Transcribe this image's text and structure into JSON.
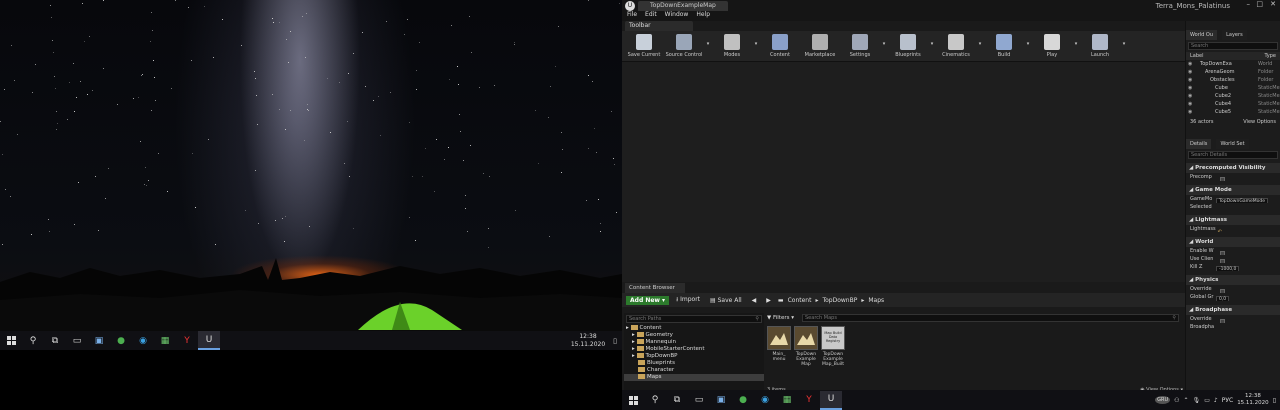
{
  "left_desktop": {
    "wallpaper": "milky-way-night-sky-with-tent",
    "taskbar": {
      "icons": [
        "windows-icon",
        "search-icon",
        "task-view-icon",
        "terminal-icon",
        "explorer-icon",
        "globe-icon",
        "edge-icon",
        "photos-icon",
        "yandex-icon",
        "unreal-icon"
      ],
      "time": "12:38",
      "date": "15.11.2020"
    }
  },
  "ue": {
    "logo": "U",
    "tab_title": "TopDownExampleMap",
    "project_name": "Terra_Mons_Palatinus",
    "menu": [
      "File",
      "Edit",
      "Window",
      "Help"
    ],
    "toolbar_tab": "Toolbar",
    "tools": [
      {
        "label": "Save Current",
        "icon": "save-icon",
        "color": "#c8d0da"
      },
      {
        "label": "Source Control",
        "icon": "source-control-icon",
        "color": "#9aa6b8"
      },
      {
        "label": "Modes",
        "icon": "modes-icon",
        "color": "#c0c0c0"
      },
      {
        "label": "Content",
        "icon": "content-icon",
        "color": "#8aa0c8"
      },
      {
        "label": "Marketplace",
        "icon": "marketplace-icon",
        "color": "#b0b0b0"
      },
      {
        "label": "Settings",
        "icon": "settings-icon",
        "color": "#a0a8b8"
      },
      {
        "label": "Blueprints",
        "icon": "blueprints-icon",
        "color": "#b8c0cc"
      },
      {
        "label": "Cinematics",
        "icon": "cinematics-icon",
        "color": "#c8c8c8"
      },
      {
        "label": "Build",
        "icon": "build-icon",
        "color": "#90a8d0"
      },
      {
        "label": "Play",
        "icon": "play-icon",
        "color": "#d8d8d8"
      },
      {
        "label": "Launch",
        "icon": "launch-icon",
        "color": "#b0b8c8"
      }
    ],
    "content_browser": {
      "tab": "Content Browser",
      "add_new": "Add New",
      "import": "Import",
      "save_all": "Save All",
      "breadcrumb": [
        "Content",
        "TopDownBP",
        "Maps"
      ],
      "search_paths_placeholder": "Search Paths",
      "filters": "Filters",
      "search_maps_placeholder": "Search Maps",
      "tree": [
        {
          "label": "Content",
          "level": 0
        },
        {
          "label": "Geometry",
          "level": 1
        },
        {
          "label": "Mannequin",
          "level": 1
        },
        {
          "label": "MobileStarterContent",
          "level": 1
        },
        {
          "label": "TopDownBP",
          "level": 1
        },
        {
          "label": "Blueprints",
          "level": 2
        },
        {
          "label": "Character",
          "level": 2
        },
        {
          "label": "Maps",
          "level": 2,
          "selected": true
        }
      ],
      "assets": [
        {
          "line1": "Main_",
          "line2": "menu",
          "line3": "",
          "type": "map"
        },
        {
          "line1": "TopDown",
          "line2": "Example",
          "line3": "Map",
          "type": "map"
        },
        {
          "line1": "TopDown",
          "line2": "Example",
          "line3": "Map_Built",
          "type": "build-data",
          "thumb_text": "Map Build Data Registry"
        }
      ],
      "item_count": "3 items",
      "view_options": "View Options"
    },
    "outliner": {
      "tabs": [
        "World Ou",
        "Layers"
      ],
      "search_placeholder": "Search",
      "col_label": "Label",
      "col_type": "Type",
      "rows": [
        {
          "label": "TopDownExa",
          "type": "World",
          "indent": 0
        },
        {
          "label": "ArenaGeom",
          "type": "Folder",
          "indent": 1
        },
        {
          "label": "Obstacles",
          "type": "Folder",
          "indent": 2
        },
        {
          "label": "Cube",
          "type": "StaticMe",
          "indent": 3
        },
        {
          "label": "Cube2",
          "type": "StaticMe",
          "indent": 3
        },
        {
          "label": "Cube4",
          "type": "StaticMe",
          "indent": 3
        },
        {
          "label": "Cube5",
          "type": "StaticMe",
          "indent": 3
        }
      ],
      "actor_count": "36 actors",
      "view_options": "View Options"
    },
    "details": {
      "tabs": [
        "Details",
        "World Set"
      ],
      "search_placeholder": "Search Details",
      "sections": [
        {
          "title": "Precomputed Visibility",
          "rows": [
            {
              "label": "Precomp",
              "kind": "check"
            }
          ]
        },
        {
          "title": "Game Mode",
          "rows": [
            {
              "label": "GameMo",
              "kind": "field",
              "value": "TopDownGameMode"
            },
            {
              "label": "Selected",
              "kind": "expander"
            }
          ]
        },
        {
          "title": "Lightmass",
          "rows": [
            {
              "label": "Lightmass",
              "kind": "reset"
            }
          ]
        },
        {
          "title": "World",
          "rows": [
            {
              "label": "Enable W",
              "kind": "check"
            },
            {
              "label": "Use Clien",
              "kind": "check"
            },
            {
              "label": "Kill Z",
              "kind": "field",
              "value": "-1000,0"
            }
          ]
        },
        {
          "title": "Physics",
          "rows": [
            {
              "label": "Override",
              "kind": "check"
            },
            {
              "label": "Global Gr",
              "kind": "field",
              "value": "0,0"
            }
          ]
        },
        {
          "title": "Broadphase",
          "rows": [
            {
              "label": "Override",
              "kind": "check"
            },
            {
              "label": "Broadpha",
              "kind": "expander"
            }
          ]
        }
      ]
    }
  },
  "right_taskbar": {
    "icons": [
      "windows-icon",
      "search-icon",
      "task-view-icon",
      "terminal-icon",
      "explorer-icon",
      "globe-icon",
      "edge-icon",
      "photos-icon",
      "yandex-icon",
      "unreal-icon"
    ],
    "tray": {
      "avatar": "GRU",
      "lang": "РУС",
      "time": "12:38",
      "date": "15.11.2020"
    }
  }
}
